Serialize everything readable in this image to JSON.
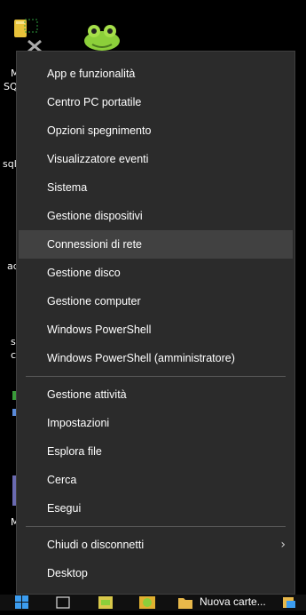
{
  "desktop": {
    "labels": [
      "M",
      "SQ",
      "sql",
      "ad",
      "s",
      "c",
      "M"
    ]
  },
  "context_menu": {
    "groups": [
      [
        "App e funzionalità",
        "Centro PC portatile",
        "Opzioni spegnimento",
        "Visualizzatore eventi",
        "Sistema",
        "Gestione dispositivi",
        "Connessioni di rete",
        "Gestione disco",
        "Gestione computer",
        "Windows PowerShell",
        "Windows PowerShell (amministratore)"
      ],
      [
        "Gestione attività",
        "Impostazioni",
        "Esplora file",
        "Cerca",
        "Esegui"
      ],
      [
        "Chiudi o disconnetti",
        "Desktop"
      ]
    ],
    "highlighted_item": "Connessioni di rete",
    "submenu_chevron": "›"
  },
  "taskbar": {
    "folder_label": "Nuova carte..."
  },
  "icons": [
    "database-icon",
    "frog-icon",
    "windows-start-icon",
    "task-view-icon",
    "folder-icon"
  ]
}
